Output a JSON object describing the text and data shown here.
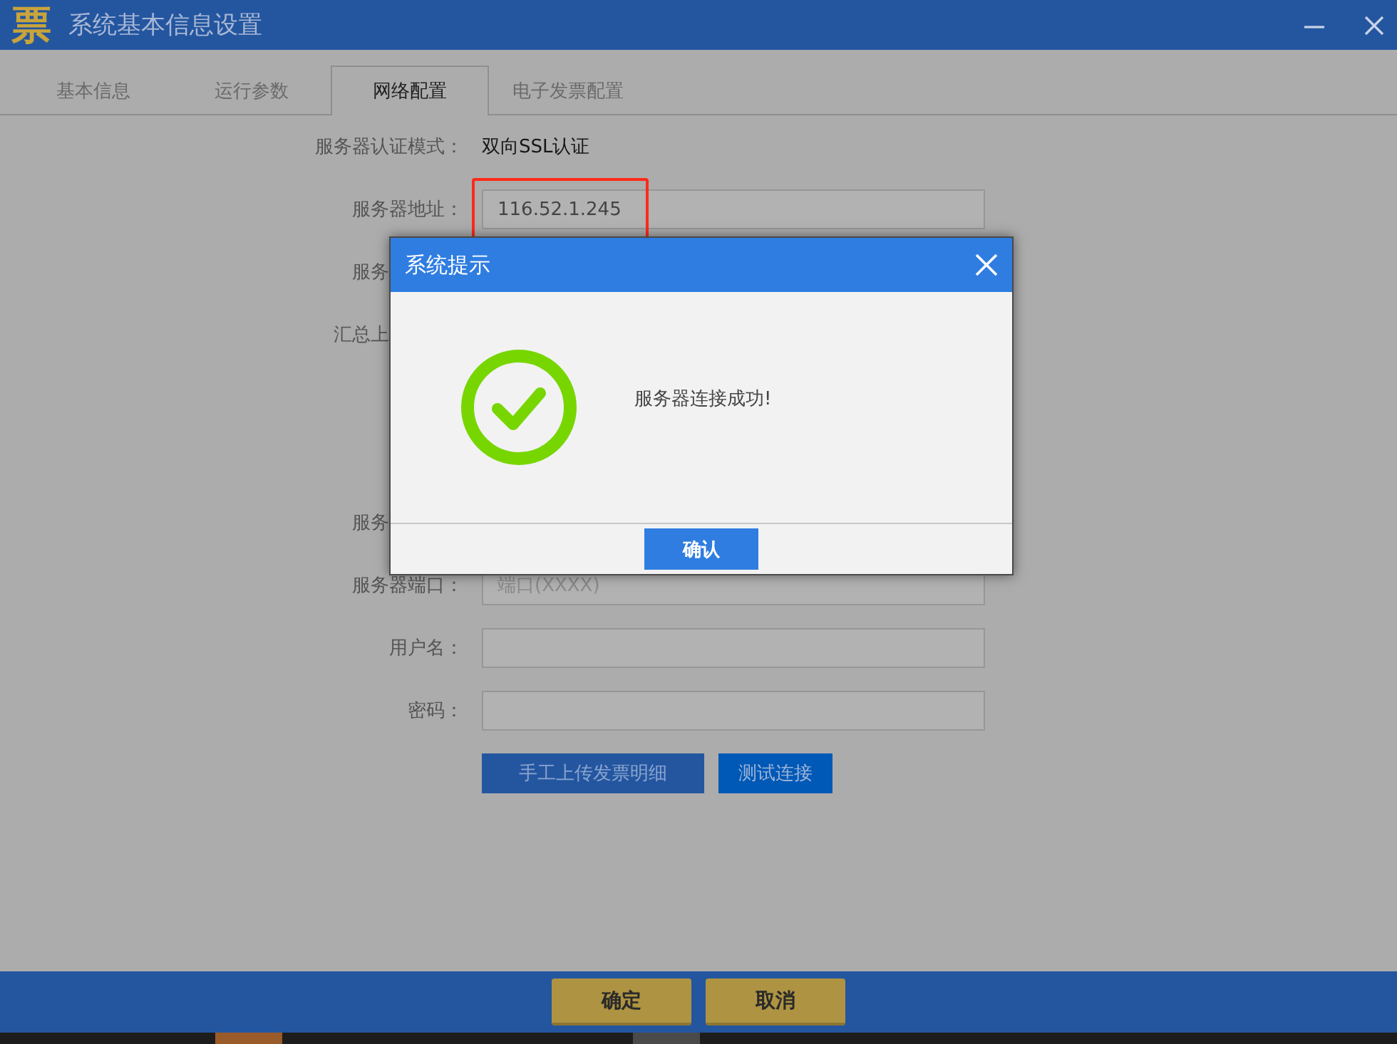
{
  "window": {
    "logo": "票",
    "title": "系统基本信息设置"
  },
  "tabs": [
    {
      "label": "基本信息",
      "selected": false
    },
    {
      "label": "运行参数",
      "selected": false
    },
    {
      "label": "网络配置",
      "selected": true
    },
    {
      "label": "电子发票配置",
      "selected": false
    }
  ],
  "form": {
    "rows": [
      {
        "kind": "text",
        "label": "服务器认证模式：",
        "value": "双向SSL认证"
      },
      {
        "kind": "field",
        "label": "服务器地址：",
        "value": "116.52.1.245",
        "highlighted": true
      },
      {
        "kind": "partial",
        "label": "服务"
      },
      {
        "kind": "partial",
        "label": "汇总上"
      },
      {
        "kind": "partial",
        "label": "服务"
      },
      {
        "kind": "field",
        "label": "服务器端口：",
        "placeholder": "端口(XXXX)",
        "highlighted": false
      },
      {
        "kind": "field",
        "label": "用户名：",
        "highlighted": false
      },
      {
        "kind": "field",
        "label": "密码：",
        "highlighted": false
      }
    ],
    "buttons": [
      {
        "label": "手工上传发票明细",
        "kind": "dark"
      },
      {
        "label": "测试连接",
        "kind": "bright"
      }
    ]
  },
  "dialog": {
    "title": "系统提示",
    "message": "服务器连接成功!",
    "button": "确认"
  },
  "footer": {
    "buttons": [
      "确定",
      "取消"
    ]
  }
}
